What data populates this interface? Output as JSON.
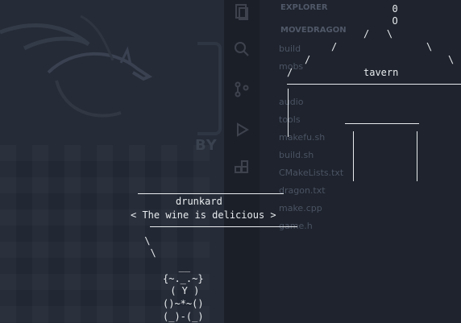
{
  "explorer": {
    "header": "EXPLORER",
    "folder": "MOVEDRAGON",
    "items": [
      "build",
      "mobs",
      "",
      "audio",
      "tools",
      "makefu.sh",
      "build.sh",
      "CMakeLists.txt",
      "dragon.txt",
      "make.cpp",
      "game.h"
    ]
  },
  "wall": {
    "letters": "BY"
  },
  "scene": {
    "tavern": {
      "roof": [
        "  0",
        "  O",
        "/   \\",
        "/     \\",
        "/       \\",
        "/         \\"
      ],
      "label": "tavern"
    },
    "drunkard": {
      "name": "drunkard",
      "speech": "< The wine is delicious >",
      "tail": [
        " \\",
        "  \\"
      ],
      "body": [
        "   __",
        "{~._.~}",
        " ( Y )",
        "()~*~()",
        "(_)-(_)"
      ]
    }
  },
  "colors": {
    "text": "#e8ecef",
    "background": "#222732"
  },
  "icons": [
    "dragon-logo-icon",
    "files-icon",
    "search-icon",
    "source-control-icon",
    "run-icon",
    "extensions-icon"
  ]
}
